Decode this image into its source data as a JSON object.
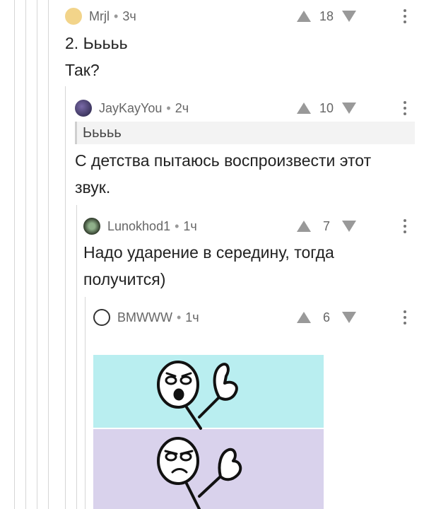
{
  "comments": [
    {
      "author": "Mrjl",
      "time": "3ч",
      "rating": "18",
      "lines": [
        "2. Ььььь",
        "Так?"
      ]
    },
    {
      "author": "JayKayYou",
      "time": "2ч",
      "rating": "10",
      "quote": "Ььььь",
      "lines": [
        "С детства пытаюсь воспроизвести этот",
        "звук."
      ]
    },
    {
      "author": "Lunokhod1",
      "time": "1ч",
      "rating": "7",
      "lines": [
        "Надо ударение в середину, тогда",
        "получится)"
      ]
    },
    {
      "author": "BMWWW",
      "time": "1ч",
      "rating": "6"
    }
  ],
  "separator": "•",
  "icons": {
    "upvote": "upvote-arrow-icon",
    "downvote": "downvote-arrow-icon",
    "more": "more-vertical-icon"
  },
  "colors": {
    "meme_top_bg": "#b9eef0",
    "meme_bottom_bg": "#d9d2ec",
    "arrow": "#999999",
    "thread_line": "#d6d6d6"
  }
}
